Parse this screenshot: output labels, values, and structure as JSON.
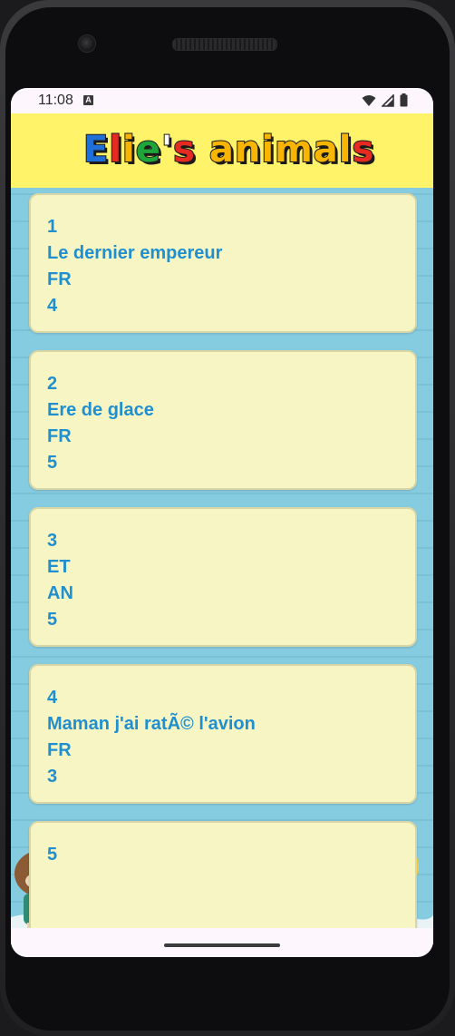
{
  "status_bar": {
    "time": "11:08",
    "notification_badge": "A",
    "icons": [
      "wifi-icon",
      "signal-icon",
      "battery-icon"
    ]
  },
  "app": {
    "title": "Elie's animals",
    "title_letters": [
      {
        "ch": "E",
        "color": "#1f6fd6"
      },
      {
        "ch": "l",
        "color": "#e52a22"
      },
      {
        "ch": "i",
        "color": "#f7b400"
      },
      {
        "ch": "e",
        "color": "#1fa63a"
      },
      {
        "ch": "'",
        "color": "#ffffff"
      },
      {
        "ch": "s",
        "color": "#e52a22"
      },
      {
        "ch": " ",
        "color": "#ffffff"
      },
      {
        "ch": "a",
        "color": "#f7b400"
      },
      {
        "ch": "n",
        "color": "#f7b400"
      },
      {
        "ch": "i",
        "color": "#f7b400"
      },
      {
        "ch": "m",
        "color": "#f7b400"
      },
      {
        "ch": "a",
        "color": "#f7b400"
      },
      {
        "ch": "l",
        "color": "#f7b400"
      },
      {
        "ch": "s",
        "color": "#e52a22"
      }
    ]
  },
  "colors": {
    "header_bg": "#fff36a",
    "content_bg": "#86cce0",
    "card_bg": "#f7f5c4",
    "card_text": "#1f8fd0"
  },
  "movies": [
    {
      "id": "1",
      "title": "Le dernier empereur",
      "lang": "FR",
      "rating": "4"
    },
    {
      "id": "2",
      "title": "Ere de glace",
      "lang": "FR",
      "rating": "5"
    },
    {
      "id": "3",
      "title": "ET",
      "lang": "AN",
      "rating": "5"
    },
    {
      "id": "4",
      "title": "Maman j'ai ratÃ© l'avion",
      "lang": "FR",
      "rating": "3"
    },
    {
      "id": "5",
      "title": "",
      "lang": "",
      "rating": ""
    }
  ]
}
